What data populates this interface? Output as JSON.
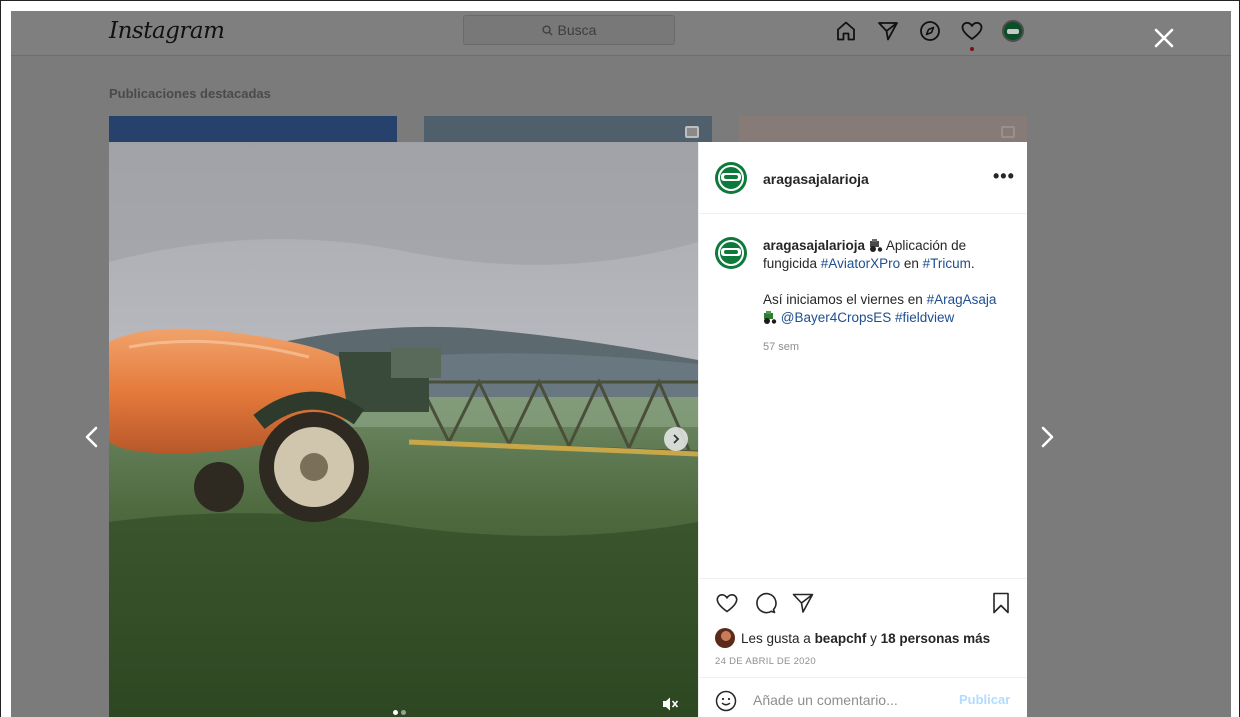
{
  "header": {
    "logo": "Instagram",
    "search_placeholder": "Busca",
    "icons": [
      "home-icon",
      "direct-icon",
      "explore-icon",
      "heart-icon",
      "profile-avatar"
    ]
  },
  "background": {
    "featured_label": "Publicaciones destacadas"
  },
  "post": {
    "username": "aragasajalarioja",
    "more": "•••",
    "caption": {
      "username": "aragasajalarioja",
      "text_1": " Aplicación de fungicida ",
      "tag_aviator": "#AviatorXPro",
      "text_en": " en ",
      "tag_tricum": "#Tricum",
      "text_dot": ".",
      "text_2": "Así iniciamos el viernes en ",
      "tag_aragasaja": "#AragAsaja",
      "mention_bayer": "@Bayer4CropsES",
      "tag_fieldview": "#fieldview",
      "time": "57 sem"
    },
    "likes": {
      "prefix": "Les gusta a ",
      "user": "beapchf",
      "middle": " y ",
      "others": "18 personas más"
    },
    "date": "24 DE ABRIL DE 2020",
    "comment_placeholder": "Añade un comentario...",
    "publish_label": "Publicar",
    "carousel": {
      "total": 2,
      "current": 1
    }
  },
  "colors": {
    "overlay": "#7b7b7b",
    "tag_blue": "#1e4f8f",
    "publish_disabled": "#b3dbff",
    "brand_green": "#0d7a3c"
  }
}
